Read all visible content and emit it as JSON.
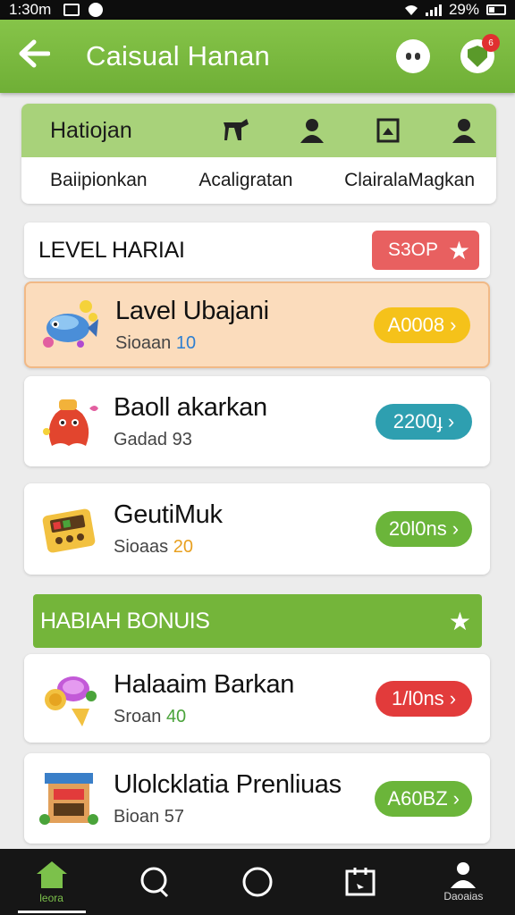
{
  "status_bar": {
    "time": "1:30m",
    "battery": "29%"
  },
  "app_bar": {
    "back_icon": "←",
    "title": "Caisual Hanan",
    "badge": "6"
  },
  "tabs": {
    "label": "Hatiojan",
    "icons": [
      "hammer-icon",
      "person-icon",
      "frame-icon",
      "person-icon"
    ],
    "items": [
      "Baiipionkan",
      "Acaligratan",
      "ClairalaMagkan"
    ]
  },
  "level_section": {
    "title": "LEVEL HARIAI",
    "shop_label": "S3OP"
  },
  "bonus_section": {
    "title": "HABIAH BONUIS"
  },
  "items": [
    {
      "name": "Lavel Ubajani",
      "sub_label": "Sioaan",
      "sub_value": "10",
      "button": "A0008",
      "button_color": "#f5c21a",
      "value_color": "#2d7fd1"
    },
    {
      "name": "Baoll akarkan",
      "sub_label": "Gadad",
      "sub_value": "93",
      "button": "2200ɟ",
      "button_color": "#2e9fb0",
      "value_color": "#444444"
    },
    {
      "name": "GeutiMuk",
      "sub_label": "Sioaas",
      "sub_value": "20",
      "button": "20l0ns",
      "button_color": "#6bb53a",
      "value_color": "#e8a020"
    },
    {
      "name": "Halaaim Barkan",
      "sub_label": "Sroan",
      "sub_value": "40",
      "button": "1/l0ns",
      "button_color": "#e23b3b",
      "value_color": "#4aa33a"
    },
    {
      "name": "Ulolcklatia Prenliuas",
      "sub_label": "Bioan",
      "sub_value": "57",
      "button": "A60BZ",
      "button_color": "#6bb53a",
      "value_color": "#444444"
    }
  ],
  "bottom_nav": [
    {
      "label": "leora",
      "icon": "home-icon"
    },
    {
      "label": "",
      "icon": "chat-heart-icon"
    },
    {
      "label": "",
      "icon": "circle-icon"
    },
    {
      "label": "",
      "icon": "wallet-icon"
    },
    {
      "label": "Daoaias",
      "icon": "profile-icon"
    }
  ]
}
